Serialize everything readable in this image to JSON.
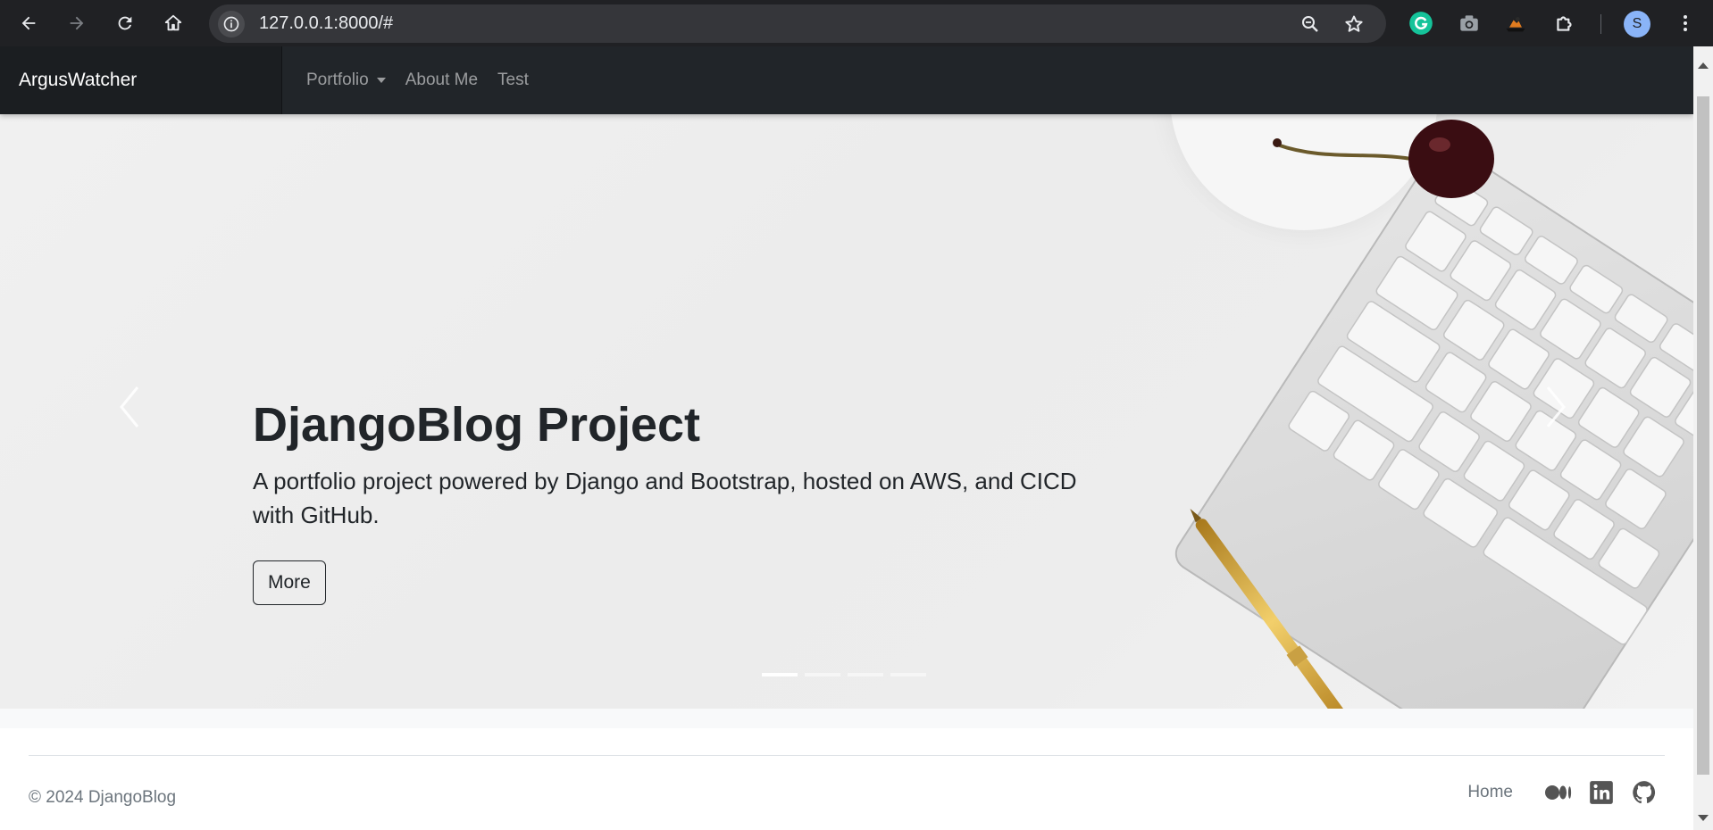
{
  "browser": {
    "url": "127.0.0.1:8000/#",
    "profile_initial": "S",
    "icons": [
      "back-icon",
      "forward-icon",
      "reload-icon",
      "home-icon",
      "site-info-icon",
      "zoom-icon",
      "bookmark-star-icon",
      "grammarly-icon",
      "camera-icon",
      "extension-tools-icon",
      "extensions-puzzle-icon",
      "menu-kebab-icon"
    ]
  },
  "navbar": {
    "brand": "ArgusWatcher",
    "links": [
      {
        "label": "Portfolio",
        "dropdown": true
      },
      {
        "label": "About Me"
      },
      {
        "label": "Test"
      }
    ]
  },
  "hero": {
    "title": "DjangoBlog Project",
    "text": "A portfolio project powered by Django and Bootstrap, hosted on AWS, and CICD with GitHub.",
    "button": "More",
    "slide_count": 4,
    "active_slide": 1
  },
  "footer": {
    "copyright": "© 2024 DjangoBlog",
    "home": "Home",
    "social": [
      "medium-icon",
      "linkedin-icon",
      "github-icon"
    ]
  },
  "colors": {
    "navbar_bg": "#212529",
    "chrome_bg": "#202124",
    "text_dark": "#212529",
    "muted": "#6c757d"
  }
}
